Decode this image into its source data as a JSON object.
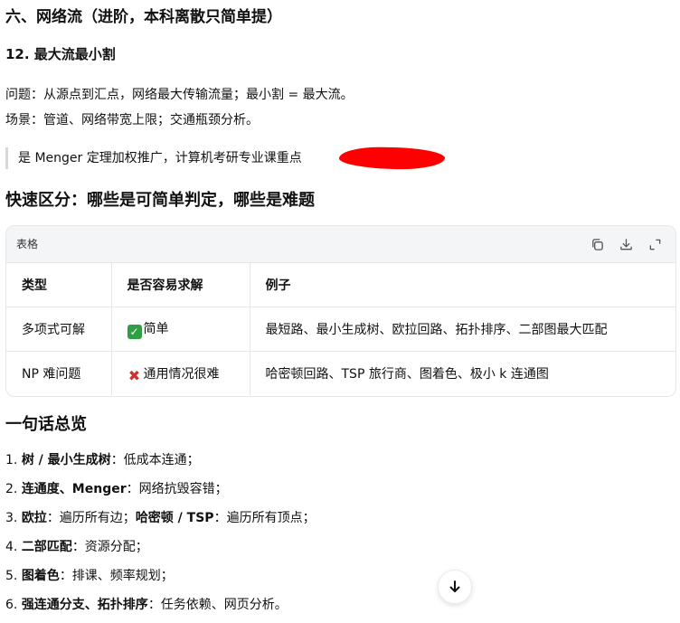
{
  "section_title": "六、网络流（进阶，本科离散只简单提）",
  "subsection_title": "12. 最大流最小割",
  "problem_line": "问题：从源点到汇点，网络最大传输流量；最小割 = 最大流。",
  "scenario_line": "场景：管道、网络带宽上限；交通瓶颈分析。",
  "quote_text": "是 Menger 定理加权推广，计算机考研专业课重点",
  "quick_heading": "快速区分：哪些是可简单判定，哪些是难题",
  "table": {
    "label": "表格",
    "headers": [
      "类型",
      "是否容易求解",
      "例子"
    ],
    "rows": [
      {
        "type": "多项式可解",
        "status": "简单",
        "example": "最短路、最小生成树、欧拉回路、拓扑排序、二部图最大匹配"
      },
      {
        "type": "NP 难问题",
        "status": "通用情况很难",
        "example": "哈密顿回路、TSP 旅行商、图着色、极小 k 连通图"
      }
    ]
  },
  "summary_heading": "一句话总览",
  "summary": [
    {
      "num": "1.",
      "bold": "树 / 最小生成树",
      "rest": "：低成本连通；"
    },
    {
      "num": "2.",
      "bold": "连通度、Menger",
      "rest": "：网络抗毁容错；"
    },
    {
      "num": "3.",
      "bold": "欧拉",
      "rest": "：遍历所有边；",
      "bold2": "哈密顿 / TSP",
      "rest2": "：遍历所有顶点；"
    },
    {
      "num": "4.",
      "bold": "二部匹配",
      "rest": "：资源分配；"
    },
    {
      "num": "5.",
      "bold": "图着色",
      "rest": "：排课、频率规划；"
    },
    {
      "num": "6.",
      "bold": "强连通分支、拓扑排序",
      "rest": "：任务依赖、网页分析。"
    }
  ],
  "icons": [
    "copy-icon",
    "download-icon",
    "expand-icon",
    "check-mark-icon",
    "cross-mark-icon",
    "arrow-down-icon"
  ],
  "colors": {
    "redaction": "#ff0000",
    "check": "#2ea043",
    "cross": "#d0312d"
  }
}
